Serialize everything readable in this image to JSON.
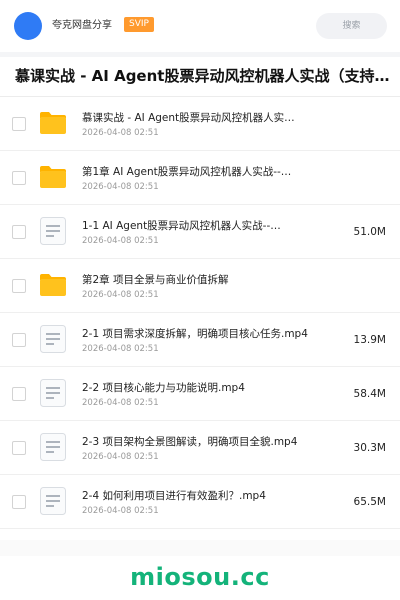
{
  "header": {
    "share_title": "夸克网盘分享",
    "svip_badge": "SVIP",
    "search_label": "搜索"
  },
  "folder_title": "慕课实战 - AI Agent股票异动风控机器人实战（支持美股…",
  "files": [
    {
      "type": "folder",
      "name": "慕课实战 - AI Agent股票异动风控机器人实…",
      "date": "2026-04-08 02:51",
      "size": ""
    },
    {
      "type": "folder",
      "name": "第1章 AI Agent股票异动风控机器人实战--…",
      "date": "2026-04-08 02:51",
      "size": ""
    },
    {
      "type": "file",
      "name": "1-1 AI Agent股票异动风控机器人实战--…",
      "date": "2026-04-08 02:51",
      "size": "51.0M"
    },
    {
      "type": "folder",
      "name": "第2章 项目全景与商业价值拆解",
      "date": "2026-04-08 02:51",
      "size": ""
    },
    {
      "type": "file",
      "name": "2-1 项目需求深度拆解，明确项目核心任务.mp4",
      "date": "2026-04-08 02:51",
      "size": "13.9M"
    },
    {
      "type": "file",
      "name": "2-2 项目核心能力与功能说明.mp4",
      "date": "2026-04-08 02:51",
      "size": "58.4M"
    },
    {
      "type": "file",
      "name": "2-3 项目架构全景图解读，明确项目全貌.mp4",
      "date": "2026-04-08 02:51",
      "size": "30.3M"
    },
    {
      "type": "file",
      "name": "2-4 如何利用项目进行有效盈利？.mp4",
      "date": "2026-04-08 02:51",
      "size": "65.5M"
    }
  ],
  "icons": {
    "folder": "folder-icon",
    "file": "document-icon"
  },
  "watermark": "miosou.cc",
  "colors": {
    "avatar": "#2f7bf5",
    "svip": "#ff9a2e",
    "folder": "#ffc21d",
    "watermark": "#14b37a"
  }
}
